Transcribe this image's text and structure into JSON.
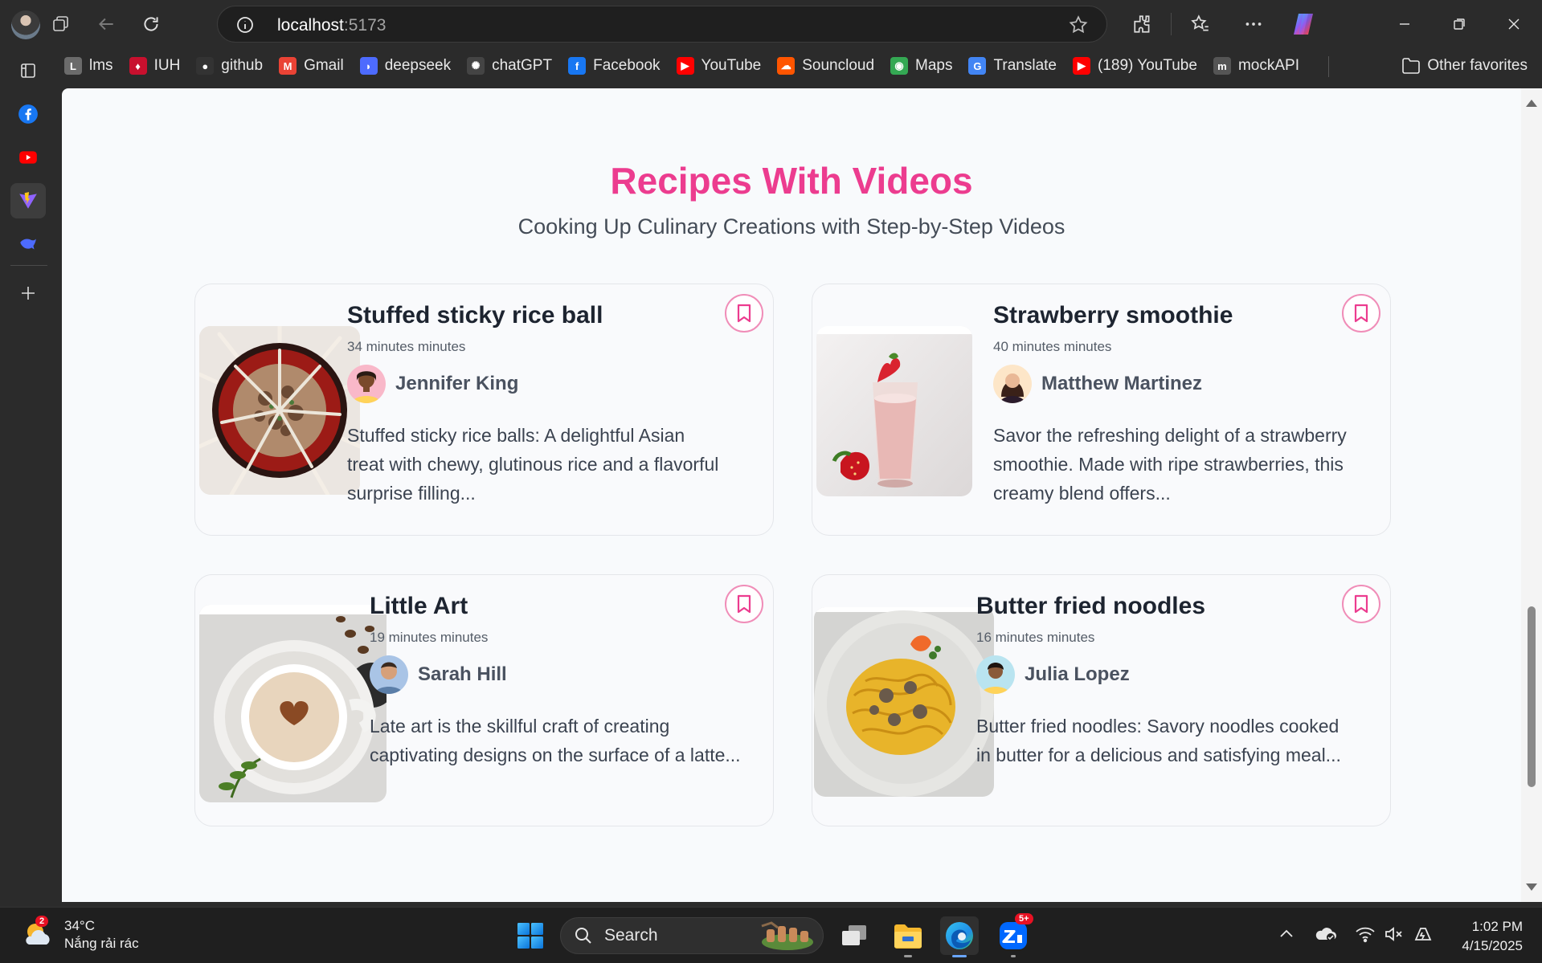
{
  "browser": {
    "url_host": "localhost",
    "url_port": ":5173",
    "bookmarks": [
      {
        "label": "lms",
        "icon": "lms-icon",
        "color": "#6b6b6b"
      },
      {
        "label": "IUH",
        "icon": "iuh-icon",
        "color": "#c8102e"
      },
      {
        "label": "github",
        "icon": "github-icon",
        "color": "#333333"
      },
      {
        "label": "Gmail",
        "icon": "gmail-icon",
        "color": "#ea4335"
      },
      {
        "label": "deepseek",
        "icon": "deepseek-icon",
        "color": "#4d6bfe"
      },
      {
        "label": "chatGPT",
        "icon": "chatgpt-icon",
        "color": "#444444"
      },
      {
        "label": "Facebook",
        "icon": "facebook-icon",
        "color": "#1877f2"
      },
      {
        "label": "YouTube",
        "icon": "youtube-icon",
        "color": "#ff0000"
      },
      {
        "label": "Souncloud",
        "icon": "soundcloud-icon",
        "color": "#ff5500"
      },
      {
        "label": "Maps",
        "icon": "maps-icon",
        "color": "#34a853"
      },
      {
        "label": "Translate",
        "icon": "translate-icon",
        "color": "#4285f4"
      },
      {
        "label": "(189) YouTube",
        "icon": "youtube-icon",
        "color": "#ff0000"
      },
      {
        "label": "mockAPI",
        "icon": "mockapi-icon",
        "color": "#555555"
      }
    ],
    "other_favorites": "Other favorites"
  },
  "page": {
    "title": "Recipes With Videos",
    "subtitle": "Cooking Up Culinary Creations with Step-by-Step Videos",
    "accent_color": "#ec3c8f",
    "recipes": [
      {
        "title": "Stuffed sticky rice ball",
        "time": "34 minutes minutes",
        "author": "Jennifer King",
        "description": "Stuffed sticky rice balls: A delightful Asian treat with chewy, glutinous rice and a flavorful surprise filling..."
      },
      {
        "title": "Strawberry smoothie",
        "time": "40 minutes minutes",
        "author": "Matthew Martinez",
        "description": "Savor the refreshing delight of a strawberry smoothie. Made with ripe strawberries, this creamy blend offers..."
      },
      {
        "title": "Little Art",
        "time": "19 minutes minutes",
        "author": "Sarah Hill",
        "description": "Late art is the skillful craft of creating captivating designs on the surface of a latte..."
      },
      {
        "title": "Butter fried noodles",
        "time": "16 minutes minutes",
        "author": "Julia Lopez",
        "description": "Butter fried noodles: Savory noodles cooked in butter for a delicious and satisfying meal..."
      }
    ]
  },
  "taskbar": {
    "weather_badge": "2",
    "temperature": "34°C",
    "weather_text": "Nắng rải rác",
    "search_label": "Search",
    "zalo_badge": "5+",
    "time": "1:02 PM",
    "date": "4/15/2025"
  }
}
